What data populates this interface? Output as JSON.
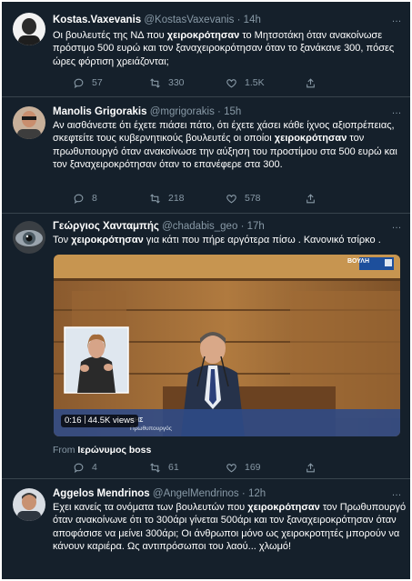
{
  "tweets": [
    {
      "name": "Kostas.Vaxevanis",
      "handle": "@KostasVaxevanis",
      "time": "14h",
      "text_parts": [
        "Οι βουλευτές της ΝΔ που ",
        "χειροκρότησαν",
        " το Μητσοτάκη όταν ανακοίνωσε πρόστιμο 500 ευρώ και τον ξαναχειροκρότησαν όταν το ξανάκανε 300, πόσες ώρες φόρτιση χρειάζονται;"
      ],
      "replies": "57",
      "retweets": "330",
      "likes": "1.5K"
    },
    {
      "name": "Manolis Grigorakis",
      "handle": "@mgrigorakis",
      "time": "15h",
      "text_parts": [
        "Αν αισθάνεστε ότι έχετε πιάσει πάτο, ότι έχετε χάσει κάθε ίχνος αξιοπρέπειας, σκεφτείτε τους κυβερνητικούς βουλευτές οι οποίοι ",
        "χειροκρότησαν",
        " τον πρωθυπουργό όταν ανακοίνωσε την αύξηση του προστίμου στα 500 ευρώ και τον ξαναχειροκρότησαν όταν το επανέφερε στα 300."
      ],
      "replies": "8",
      "retweets": "218",
      "likes": "578"
    },
    {
      "name": "Γεώργιος Χανταμπής",
      "handle": "@chadabis_geo",
      "time": "17h",
      "text_parts": [
        "Τον ",
        "χειροκρότησαν",
        " για κάτι που πήρε αργότερα πίσω .  Κανονικό τσίρκο ."
      ],
      "video": {
        "duration": "0:16",
        "views": "44.5K views",
        "channel_logo": "ΒΟΥΛΗ",
        "chyron_name": "ΚΗΣ",
        "chyron_sub": "Πρωθυπουργός"
      },
      "from_label": "From",
      "from_source": "Ιερώνυμος boss",
      "replies": "4",
      "retweets": "61",
      "likes": "169"
    },
    {
      "name": "Aggelos Mendrinos",
      "handle": "@AngelMendrinos",
      "time": "12h",
      "text_parts": [
        "Εχει κανείς τα ονόματα των βουλευτών που ",
        "χειροκρότησαν",
        " τον Πρωθυπουργό όταν ανακοίνωνε ότι το 300άρι γίνεται 500άρι και τον ξαναχειροκρότησαν όταν αποφάσισε να μείνει 300άρι; Οι άνθρωποι μόνο ως χειροκροτητές μπορούν να κάνουν καριέρα. Ως αντιπρόσωποι του λαού... χλωμό!"
      ]
    }
  ],
  "more_icon": "…",
  "colors": {
    "background": "#15202b",
    "text": "#ffffff",
    "secondary": "#8899a6",
    "divider": "#38444d"
  }
}
